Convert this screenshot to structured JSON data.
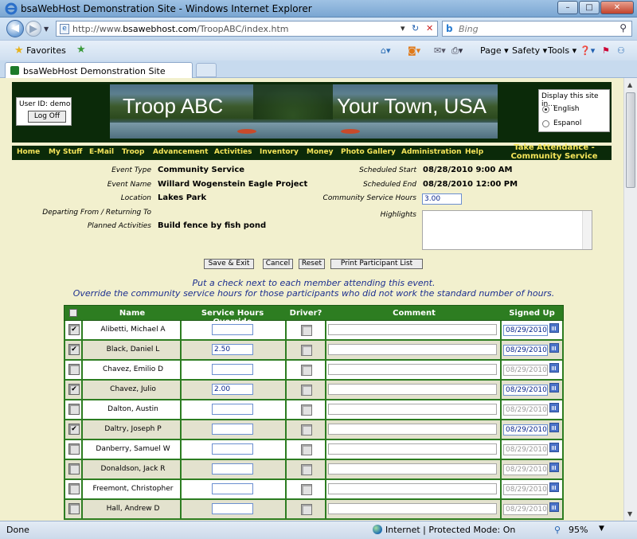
{
  "window": {
    "title": "bsaWebHost Demonstration Site - Windows Internet Explorer",
    "minimize": "–",
    "maximize": "□",
    "close": "✕"
  },
  "addressbar": {
    "url_prefix": "http://www.",
    "url_domain": "bsawebhost.com",
    "url_path": "/TroopABC/index.htm",
    "search_placeholder": "Bing"
  },
  "commandbar": {
    "favorites_label": "Favorites",
    "page_label": "Page",
    "safety_label": "Safety",
    "tools_label": "Tools"
  },
  "tab": {
    "label": "bsaWebHost Demonstration Site"
  },
  "site": {
    "user_id_label": "User ID: demo",
    "logoff_label": "Log Off",
    "banner_left": "Troop ABC",
    "banner_right": "Your Town, USA",
    "lang_title": "Display this site in...",
    "lang_english": "English",
    "lang_espanol": "Espanol",
    "nav": [
      "Home",
      "My Stuff",
      "E-Mail",
      "Troop",
      "Advancement",
      "Activities",
      "Inventory",
      "Money",
      "Photo Gallery",
      "Administration",
      "Help"
    ],
    "page_heading_1": "Take Attendance -",
    "page_heading_2": "Community Service"
  },
  "event": {
    "event_type_label": "Event Type",
    "event_type": "Community Service",
    "event_name_label": "Event Name",
    "event_name": "Willard Wogenstein Eagle Project",
    "location_label": "Location",
    "location": "Lakes Park",
    "departing_label": "Departing From / Returning To",
    "planned_label": "Planned Activities",
    "planned": "Build fence by fish pond",
    "sched_start_label": "Scheduled Start",
    "sched_start": "08/28/2010 9:00 AM",
    "sched_end_label": "Scheduled End",
    "sched_end": "08/28/2010 12:00 PM",
    "hours_label": "Community Service Hours",
    "hours": "3.00",
    "highlights_label": "Highlights"
  },
  "buttons": {
    "save_exit": "Save & Exit",
    "cancel": "Cancel",
    "reset": "Reset",
    "print": "Print Participant List"
  },
  "instructions": {
    "line1": "Put a check next to each member attending this event.",
    "line2": "Override the community service hours for those participants who did not work the standard number of hours."
  },
  "table": {
    "headers": {
      "name": "Name",
      "hours": "Service Hours Override",
      "driver": "Driver?",
      "comment": "Comment",
      "signed": "Signed Up"
    },
    "rows": [
      {
        "checked": true,
        "name": "Alibetti, Michael A",
        "hours": "",
        "signed": "08/29/2010",
        "signed_active": true
      },
      {
        "checked": true,
        "name": "Black, Daniel L",
        "hours": "2.50",
        "signed": "08/29/2010",
        "signed_active": true
      },
      {
        "checked": false,
        "name": "Chavez, Emilio D",
        "hours": "",
        "signed": "08/29/2010",
        "signed_active": false
      },
      {
        "checked": true,
        "name": "Chavez, Julio",
        "hours": "2.00",
        "signed": "08/29/2010",
        "signed_active": true
      },
      {
        "checked": false,
        "name": "Dalton, Austin",
        "hours": "",
        "signed": "08/29/2010",
        "signed_active": false
      },
      {
        "checked": true,
        "name": "Daltry, Joseph P",
        "hours": "",
        "signed": "08/29/2010",
        "signed_active": true
      },
      {
        "checked": false,
        "name": "Danberry, Samuel W",
        "hours": "",
        "signed": "08/29/2010",
        "signed_active": false
      },
      {
        "checked": false,
        "name": "Donaldson, Jack R",
        "hours": "",
        "signed": "08/29/2010",
        "signed_active": false
      },
      {
        "checked": false,
        "name": "Freemont, Christopher",
        "hours": "",
        "signed": "08/29/2010",
        "signed_active": false
      },
      {
        "checked": false,
        "name": "Hall, Andrew D",
        "hours": "",
        "signed": "08/29/2010",
        "signed_active": false
      }
    ]
  },
  "statusbar": {
    "status": "Done",
    "zone": "Internet | Protected Mode: On",
    "zoom": "95%"
  }
}
